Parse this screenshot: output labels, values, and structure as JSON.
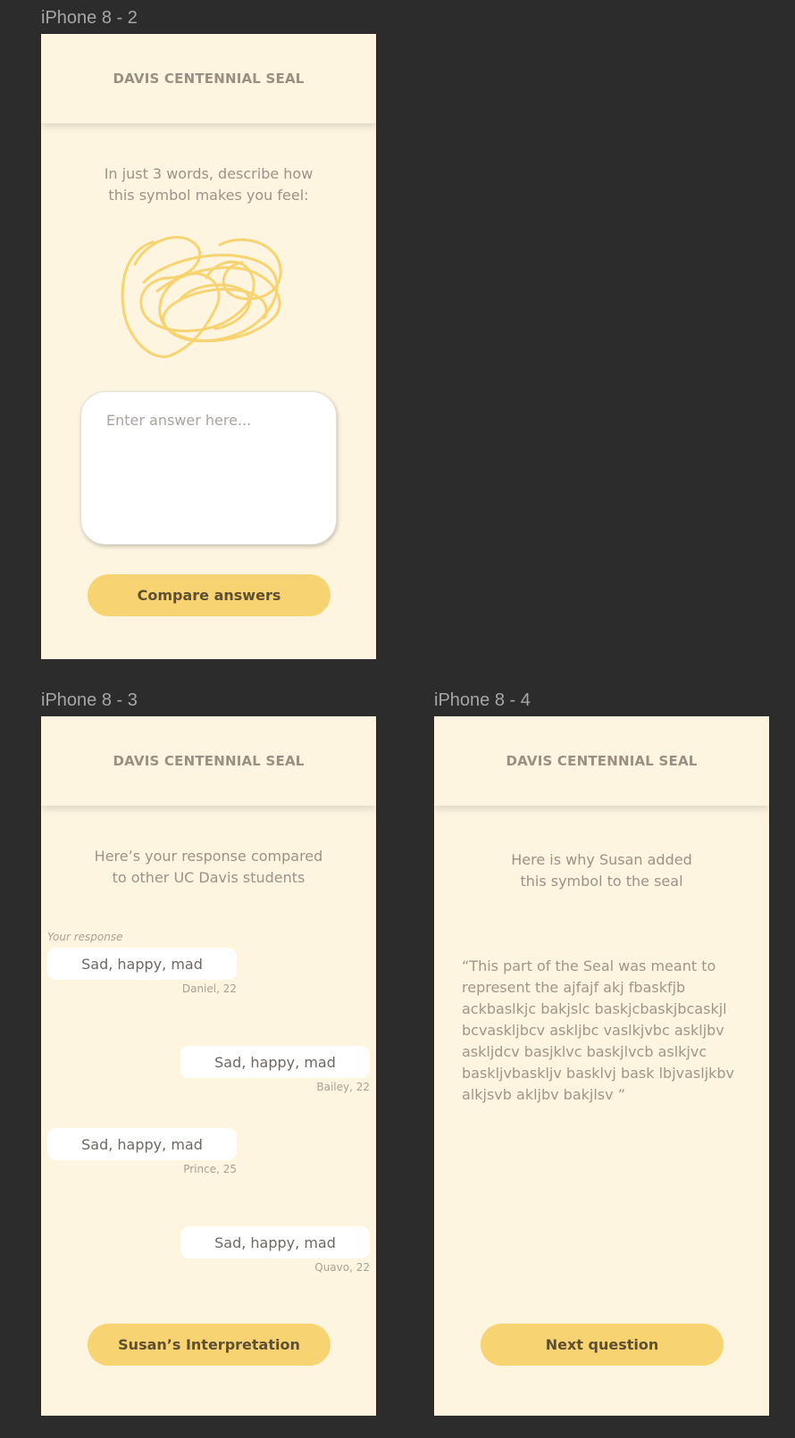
{
  "frames": {
    "f2": {
      "label": "iPhone 8 - 2",
      "header_title": "DAVIS CENTENNIAL SEAL",
      "prompt_line1": "In just 3 words, describe how",
      "prompt_line2": "this symbol makes you feel:",
      "answer_placeholder": "Enter answer here...",
      "button_label": "Compare answers"
    },
    "f3": {
      "label": "iPhone 8 - 3",
      "header_title": "DAVIS CENTENNIAL SEAL",
      "prompt_line1": "Here’s your response compared",
      "prompt_line2": "to other UC Davis students",
      "your_response_label": "Your response",
      "responses": [
        {
          "text": "Sad, happy, mad",
          "meta": "Daniel, 22"
        },
        {
          "text": "Sad, happy, mad",
          "meta": "Bailey, 22"
        },
        {
          "text": "Sad, happy, mad",
          "meta": "Prince, 25"
        },
        {
          "text": "Sad, happy, mad",
          "meta": "Quavo, 22"
        }
      ],
      "button_label": "Susan’s Interpretation"
    },
    "f4": {
      "label": "iPhone 8 - 4",
      "header_title": "DAVIS CENTENNIAL SEAL",
      "prompt_line1": "Here is why Susan added",
      "prompt_line2": "this symbol to the seal",
      "quote": "“This part of the Seal was meant to represent the ajfajf akj fbaskfjb ackbaslkjc bakjslc baskjcbaskjbcaskjl bcvaskljbcv askljbc vaslkjvbc askljbv askljdcv basjklvc baskjlvcb aslkjvc baskljvbaskljv basklvj bask lbjvasljkbv alkjsvb akljbv bakjlsv ”",
      "button_label": "Next question"
    }
  },
  "colors": {
    "canvas": "#2c2c2c",
    "frame_bg": "#fdf5df",
    "accent": "#f7d471",
    "scribble": "#f7d471"
  },
  "icons": [
    "scribble-symbol-icon"
  ]
}
